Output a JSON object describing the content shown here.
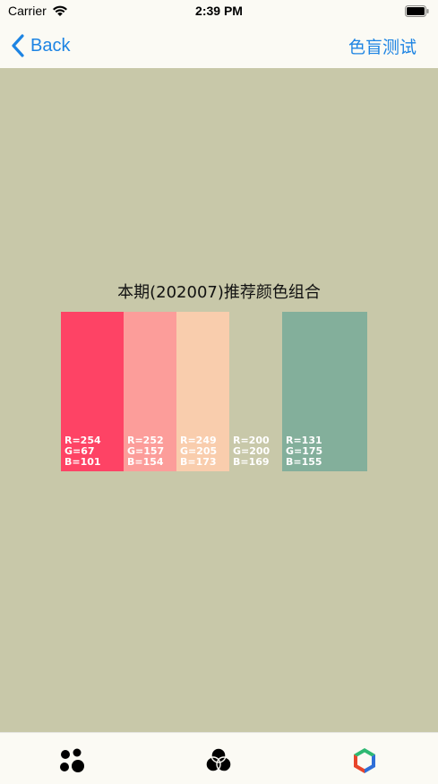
{
  "status_bar": {
    "carrier": "Carrier",
    "time": "2:39 PM"
  },
  "nav": {
    "back_label": "Back",
    "right_label": "色盲测试"
  },
  "content": {
    "title": "本期(202007)推荐颜色组合",
    "swatches": [
      {
        "color": "#fe4365",
        "r": "R=254",
        "g": "G=67",
        "b": "B=101"
      },
      {
        "color": "#fc9d9a",
        "r": "R=252",
        "g": "G=157",
        "b": "B=154"
      },
      {
        "color": "#f9cdad",
        "r": "R=249",
        "g": "G=205",
        "b": "B=173"
      },
      {
        "color": "#c8c8a9",
        "r": "R=200",
        "g": "G=200",
        "b": "B=169"
      },
      {
        "color": "#83af9b",
        "r": "R=131",
        "g": "G=175",
        "b": "B=155"
      }
    ]
  },
  "tab_bar": {
    "items": [
      {
        "icon": "dots-icon"
      },
      {
        "icon": "color-circles-icon"
      },
      {
        "icon": "cube-icon"
      }
    ]
  },
  "colors": {
    "accent": "#1d84e3",
    "background": "#c8c8a9",
    "bar_background": "#fbfaf4"
  }
}
